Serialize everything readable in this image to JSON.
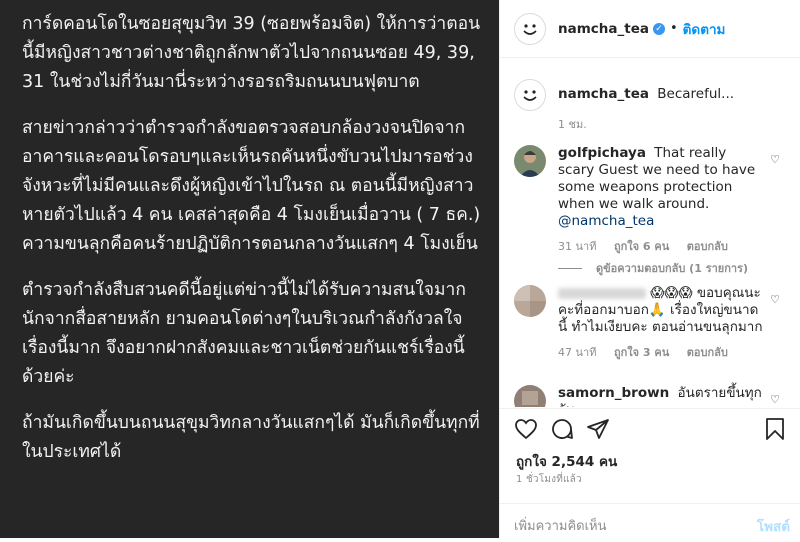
{
  "post_image": {
    "paragraphs": [
      "การ์ดคอนโดในซอยสุขุมวิท 39 (ซอยพร้อมจิต) ให้การว่าตอนนี้มีหญิงสาวชาวต่างชาติถูกลักพาตัวไปจากถนนซอย 49, 39, 31 ในช่วงไม่กี่วันมานี่ระหว่างรอรถริมถนนบนฟุตบาต",
      "สายข่าวกล่าวว่าตำรวจกำลังขอตรวจสอบกล้องวงจนปิดจากอาคารและคอนโดรอบๆและเห็นรถคันหนึ่งขับวนไปมารอช่วงจังหวะที่ไม่มีคนและดึงผู้หญิงเข้าไปในรถ ณ ตอนนี้มีหญิงสาวหายตัวไปแล้ว 4 คน เคสล่าสุดคือ 4 โมงเย็นเมื่อวาน ( 7 ธค.) ความขนลุกคือคนร้ายปฏิบัติการตอนกลางวันแสกๆ 4 โมงเย็น",
      "ตำรวจกำลังสืบสวนคดีนี้อยู่แต่ข่าวนี้ไม่ได้รับความสนใจมากนักจากสื่อสายหลัก ยามคอนโดต่างๆในบริเวณกำลังกังวลใจเรื่องนี้มาก จึงอยากฝากสังคมและชาวเน็ตช่วยกันแชร์เรื่องนี้ด้วยค่ะ",
      "ถ้ามันเกิดขึ้นบนถนนสุขุมวิทกลางวันแสกๆได้ มันก็เกิดขึ้นทุกที่ในประเทศได้"
    ]
  },
  "header": {
    "username": "namcha_tea",
    "separator": "•",
    "follow_label": "ติดตาม"
  },
  "caption": {
    "username": "namcha_tea",
    "text": "Becareful...",
    "time": "1 ชม."
  },
  "comments": [
    {
      "username": "golfpichaya",
      "text": "That really scary Guest we need to have some weapons protection when we walk around.",
      "mention": "@namcha_tea",
      "time": "31 นาที",
      "likes": "ถูกใจ 6 คน",
      "reply": "ตอบกลับ"
    },
    {
      "username": "",
      "emojis": "😱😱😱",
      "text": "ขอบคุณนะคะที่ออกมาบอก🙏 เรื่องใหญ่ขนาดนี้ ทำไมเงียบคะ ตอนอ่านขนลุกมาก",
      "time": "47 นาที",
      "likes": "ถูกใจ 3 คน",
      "reply": "ตอบกลับ"
    },
    {
      "username": "samorn_brown",
      "text": "อันตรายขึ้นทุกวัน"
    }
  ],
  "view_replies": "ดูข้อความตอบกลับ (1 รายการ)",
  "actions": {
    "likes": "ถูกใจ 2,544 คน",
    "ago": "1 ชั่วโมงที่แล้ว"
  },
  "add_comment": {
    "placeholder": "เพิ่มความคิดเห็น",
    "post_label": "โพสต์"
  },
  "colors": {
    "image_bg": "#262626",
    "link": "#0095f6",
    "verified": "#3897f0",
    "muted": "#8e8e8e"
  }
}
